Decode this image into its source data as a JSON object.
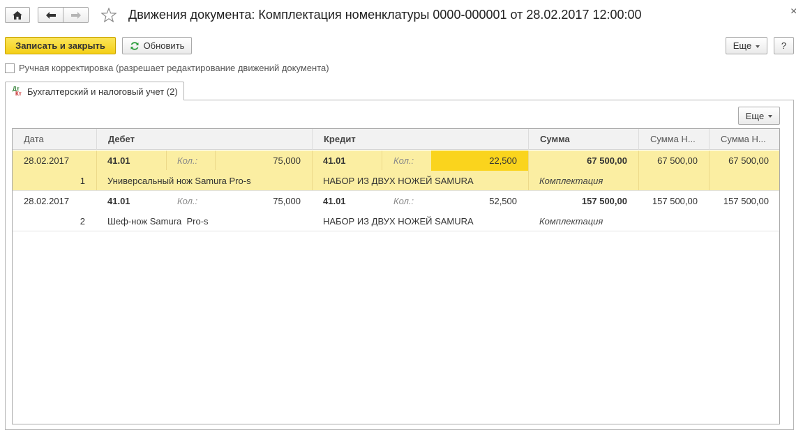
{
  "window": {
    "title": "Движения документа: Комплектация номенклатуры 0000-000001 от 28.02.2017 12:00:00",
    "close_glyph": "×"
  },
  "toolbar": {
    "save_close_label": "Записать и закрыть",
    "refresh_label": "Обновить",
    "more_label": "Еще",
    "help_label": "?"
  },
  "manual_edit": {
    "label": "Ручная корректировка (разрешает редактирование движений документа)",
    "checked": false
  },
  "tabs": [
    {
      "label": "Бухгалтерский и налоговый учет (2)",
      "icon": "dt-kt-icon",
      "icon_top": "Дт",
      "icon_bottom": "Кт"
    }
  ],
  "panel": {
    "more_label": "Еще"
  },
  "table": {
    "columns": [
      "Дата",
      "Дебет",
      "Кредит",
      "Сумма",
      "Сумма Н...",
      "Сумма Н..."
    ],
    "rows": [
      {
        "date": "28.02.2017",
        "num": "1",
        "debit_account": "41.01",
        "debit_qty_label": "Кол.:",
        "debit_qty": "75,000",
        "debit_sub": "Универсальный нож Samura Pro-s",
        "credit_account": "41.01",
        "credit_qty_label": "Кол.:",
        "credit_qty": "22,500",
        "credit_sub": "НАБОР ИЗ ДВУХ НОЖЕЙ SAMURA",
        "sum": "67 500,00",
        "sum_content": "Комплектация",
        "sum_nu1": "67 500,00",
        "sum_nu2": "67 500,00",
        "selected": true
      },
      {
        "date": "28.02.2017",
        "num": "2",
        "debit_account": "41.01",
        "debit_qty_label": "Кол.:",
        "debit_qty": "75,000",
        "debit_sub": "Шеф-нож Samura  Pro-s",
        "credit_account": "41.01",
        "credit_qty_label": "Кол.:",
        "credit_qty": "52,500",
        "credit_sub": "НАБОР ИЗ ДВУХ НОЖЕЙ SAMURA",
        "sum": "157 500,00",
        "sum_content": "Комплектация",
        "sum_nu1": "157 500,00",
        "sum_nu2": "157 500,00",
        "selected": false
      }
    ]
  },
  "colors": {
    "primary_button": "#f4cf17",
    "selected_row": "#fbeea2",
    "active_cell": "#fad41d"
  }
}
